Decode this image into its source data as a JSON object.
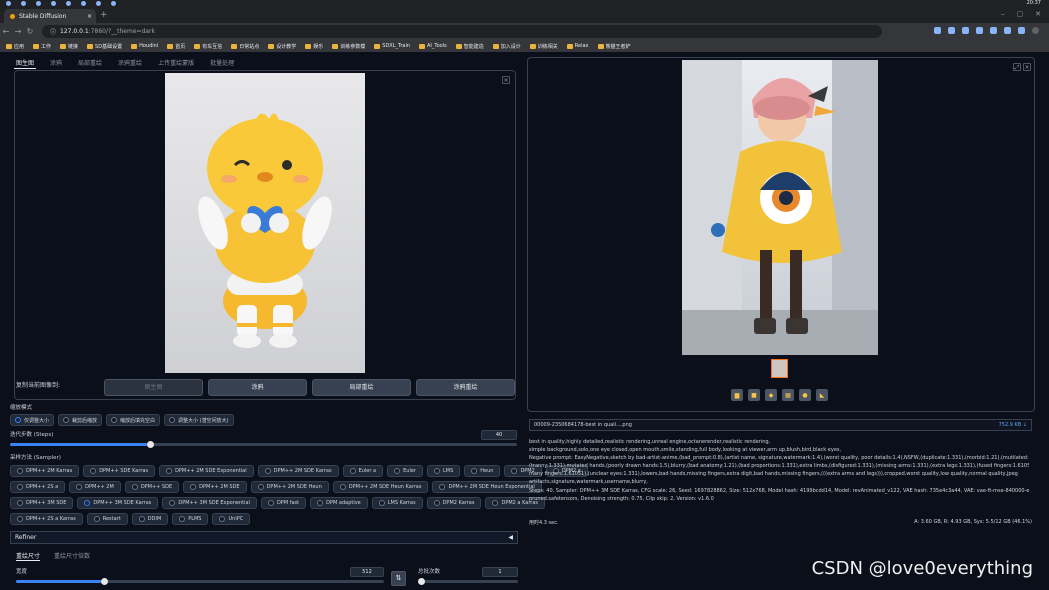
{
  "browser": {
    "tab_title": "Stable Diffusion",
    "new_tab": "+",
    "url_host": "127.0.0.1",
    "url_rest": ":7860/?__theme=dark",
    "clock": "20:37",
    "bookmarks": [
      "应用",
      "工作",
      "链接",
      "SD基础设置",
      "Houdini",
      "首页",
      "有车互信",
      "日常站点",
      "设计教学",
      "娱乐",
      "训练参数模",
      "SDXL_Train",
      "AI_Tools",
      "智能建造",
      "加入设计",
      "训练相关",
      "Relax",
      "熊猫王者铲"
    ]
  },
  "left": {
    "tabs": [
      "图生图",
      "涂鸦",
      "局部重绘",
      "涂鸦重绘",
      "上传重绘蒙版",
      "批量处理"
    ],
    "copy_label": "复制当前图像到:",
    "copy_buttons": [
      "图生图",
      "涂鸦",
      "局部重绘",
      "涂鸦重绘"
    ],
    "resize_label": "缩放模式",
    "resize_modes": [
      "仅调整大小",
      "裁剪后缩放",
      "缩放后填充空白",
      "调整大小 (潜空间放大)"
    ],
    "steps_label": "迭代步数 (Steps)",
    "steps_value": "40",
    "sampler_label": "采样方法 (Sampler)",
    "samplers": [
      [
        "DPM++ 2M Karras",
        "DPM++ SDE Karras",
        "DPM++ 2M SDE Exponential",
        "DPM++ 2M SDE Karras",
        "Euler a",
        "Euler",
        "LMS",
        "Heun",
        "DPM2",
        "DPM2 a"
      ],
      [
        "DPM++ 2S a",
        "DPM++ 2M",
        "DPM++ SDE",
        "DPM++ 2M SDE",
        "DPM++ 2M SDE Heun",
        "DPM++ 2M SDE Heun Karras",
        "DPM++ 2M SDE Heun Exponential"
      ],
      [
        "DPM++ 3M SDE",
        "DPM++ 3M SDE Karras",
        "DPM++ 3M SDE Exponential",
        "DPM fast",
        "DPM adaptive",
        "LMS Karras",
        "DPM2 Karras",
        "DPM2 a Karras"
      ],
      [
        "DPM++ 2S a Karras",
        "Restart",
        "DDIM",
        "PLMS",
        "UniPC"
      ]
    ],
    "sampler_selected": "DPM++ 3M SDE Karras",
    "refiner_label": "Refiner",
    "size_tabs": [
      "重绘尺寸",
      "重绘尺寸倍数"
    ],
    "width_label": "宽度",
    "width_value": "512",
    "batch_label": "总批次数",
    "batch_value": "1"
  },
  "right": {
    "filename": "00009-2350684178-best in quali....png",
    "filesize": "752.9 KB ↓",
    "info_lines": [
      "best in quality,highly detailed,realistic rendering,unreal engine,octanerender,realistic rendering,",
      "simple background,solo,one eye closed,open mouth,smile,standing,full body,looking at viewer,arm up,blush,bird,black eyes,",
      "Negative prompt: EasyNegative,sketch by bad-artist-anime,(bad_prompt:0.8),(artist name, signature,watermark:1.4),(worst quality, poor details:1.4),NSFW,(duplicate:1.331),(morbid:1.21),(mutilated:1.21),",
      "(tranny:1.331),mutated hands,(poorly drawn hands:1.5),blurry,(bad anatomy:1.21),(bad proportions:1.331),extra limbs,(disfigured:1.331),(missing arms:1.331),(extra legs:1.331),(fused fingers:1.61051),(too",
      "many fingers:1.61051),(unclear eyes:1.331),lowers,bad hands,missing fingers,extra digit,bad hands,missing fingers,(((extra arms and legs))),cropped,worst quality,low quality,normal quality,jpeg",
      "artifacts,signature,watermark,username,blurry,",
      "Steps: 40, Sampler: DPM++ 3M SDE Karras, CFG scale: 26, Seed: 1697828862, Size: 512x768, Model hash: 4199bcdd14, Model: revAnimated_v122, VAE hash: 735e4c3a44, VAE: vae-ft-mse-840000-ema-",
      "pruned.safetensors, Denoising strength: 0.75, Clip skip: 2, Version: v1.6.0"
    ],
    "time": "用时4.3 sec.",
    "memory": "A: 3.60 GB, R: 4.93 GB, Sys: 5.5/12 GB (46.1%)"
  },
  "watermark": "CSDN @love0everything"
}
